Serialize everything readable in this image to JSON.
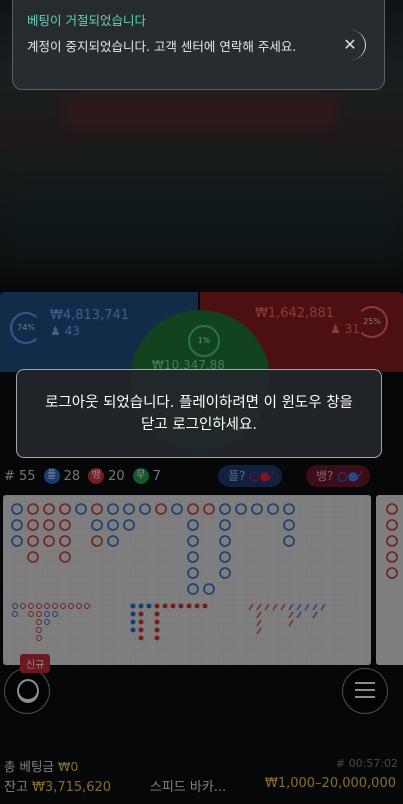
{
  "notification": {
    "title": "베팅이 거절되었습니다",
    "message": "계정이 중지되었습니다. 고객 센터에 연락해 주세요.",
    "close_icon": "close-icon"
  },
  "betting": {
    "player": {
      "percent": "74%",
      "amount": "₩4,813,741",
      "count": "43"
    },
    "banker": {
      "percent": "25%",
      "amount": "₩1,642,881",
      "count": "31"
    },
    "tie": {
      "percent": "1%",
      "amount": "₩10,347.88"
    }
  },
  "dialog": {
    "message": "로그아웃 되었습니다. 플레이하려면 이 윈도우 창을 닫고 로그인하세요."
  },
  "stats": {
    "total": "# 55",
    "player_label": "플",
    "player_count": "28",
    "banker_label": "뱅",
    "banker_count": "20",
    "tie_label": "무",
    "tie_count": "7",
    "player_predict": "플?",
    "banker_predict": "뱅?"
  },
  "bottom": {
    "new_badge": "신규",
    "total_bet_label": "총 베팅금",
    "total_bet_value": "₩0",
    "round": "# 00:57:02",
    "balance_label": "잔고",
    "balance_value": "₩3,715,620",
    "table_name": "스피드 바카...",
    "limits": "₩1,000–20,000,000"
  },
  "colors": {
    "player": "#2d6ed6",
    "banker": "#d23a3a",
    "tie": "#2aa14d",
    "accent": "#f3c64d"
  }
}
